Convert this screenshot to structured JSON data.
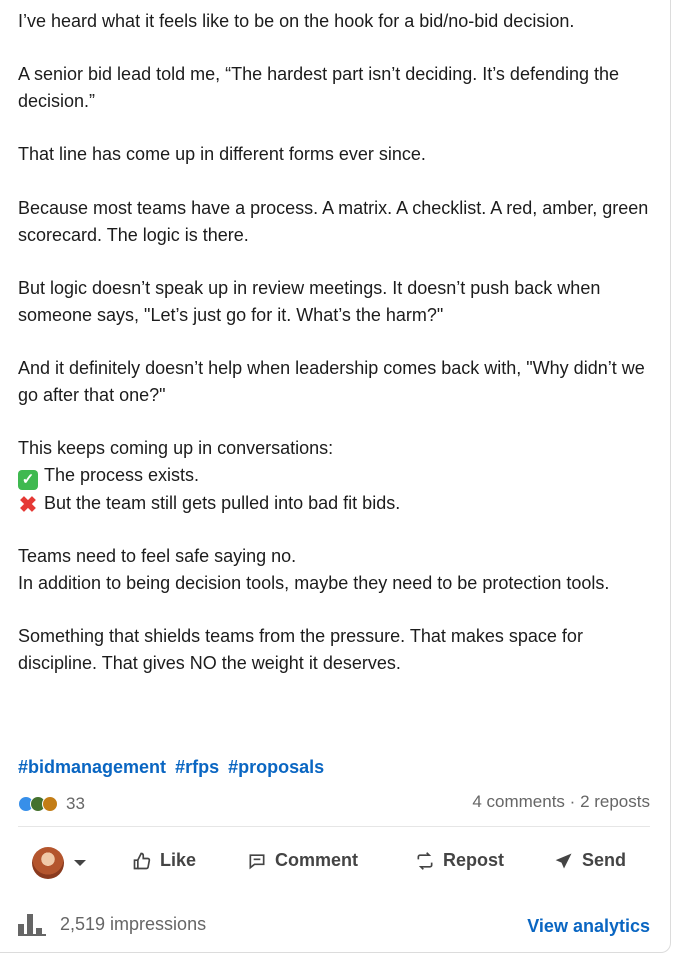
{
  "post": {
    "paragraphs": [
      {
        "lines": [
          "I’ve heard what it feels like to be on the hook for a bid/no-bid decision."
        ]
      },
      {
        "lines": [
          "A senior bid lead told me, “The hardest part isn’t deciding. It’s defending the decision.”"
        ]
      },
      {
        "lines": [
          "That line has come up in different forms ever since."
        ]
      },
      {
        "lines": [
          "Because most teams have a process. A matrix. A checklist. A red, amber, green scorecard. The logic is there."
        ]
      },
      {
        "lines": [
          "But logic doesn’t speak up in review meetings. It doesn’t push back when someone says, \"Let’s just go for it. What’s the harm?\""
        ]
      },
      {
        "lines": [
          "And it definitely doesn’t help when leadership comes back with, \"Why didn’t we go after that one?\""
        ]
      }
    ],
    "list_intro": "This keeps coming up in conversations:",
    "list_items": [
      {
        "icon": "check-mark-icon",
        "text": "The process exists."
      },
      {
        "icon": "cross-mark-icon",
        "text": "But the team still gets pulled into bad fit bids."
      }
    ],
    "para_after_list_1": "Teams need to feel safe saying no.",
    "para_after_list_2": "In addition to being decision tools, maybe they need to be protection tools.",
    "closing": "Something that shields teams from the pressure. That makes space for discipline. That gives NO the weight it deserves.",
    "hashtags": [
      "#bidmanagement",
      "#rfps",
      "#proposals"
    ]
  },
  "stats": {
    "reaction_count": "33",
    "comments": "4 comments",
    "separator": "·",
    "reposts": "2 reposts"
  },
  "actions": {
    "like": "Like",
    "comment": "Comment",
    "repost": "Repost",
    "send": "Send"
  },
  "footer": {
    "impressions": "2,519 impressions",
    "analytics": "View analytics"
  },
  "colors": {
    "link": "#0a66c2",
    "check": "#3fb950",
    "cross": "#e53935"
  }
}
